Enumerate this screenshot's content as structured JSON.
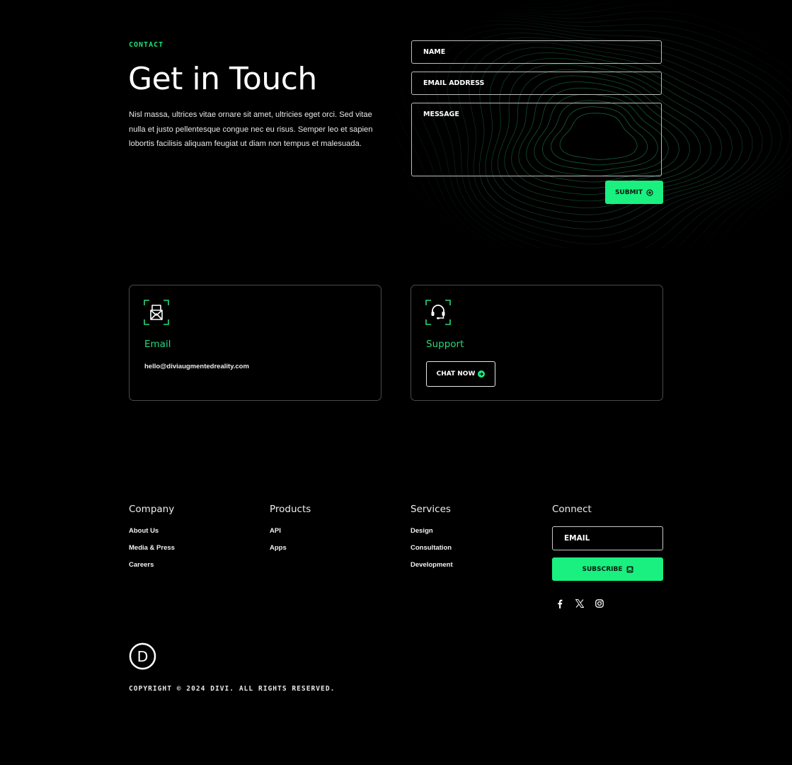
{
  "colors": {
    "accent": "#19f080",
    "accent_text": "#2ad67c",
    "background": "#000000",
    "border": "#bdbdbd"
  },
  "contact": {
    "eyebrow": "CONTACT",
    "title": "Get in Touch",
    "intro": "Nisl massa, ultrices vitae ornare sit amet, ultricies eget orci. Sed vitae nulla et justo pellentesque congue nec eu risus. Semper leo et sapien lobortis facilisis aliquam feugiat ut diam non tempus et malesuada."
  },
  "form": {
    "name_placeholder": "NAME",
    "email_placeholder": "EMAIL ADDRESS",
    "message_placeholder": "MESSAGE",
    "name_value": "",
    "email_value": "",
    "message_value": "",
    "submit_label": "SUBMIT",
    "submit_icon": "target-circle-icon"
  },
  "cards": {
    "email": {
      "icon": "envelope-icon",
      "title": "Email",
      "text": "hello@diviaugmentedreality.com"
    },
    "support": {
      "icon": "headset-icon",
      "title": "Support",
      "button_label": "CHAT NOW",
      "button_icon": "arrow-circle-right-icon"
    }
  },
  "footer": {
    "columns": [
      {
        "title": "Company",
        "links": [
          "About Us",
          "Media & Press",
          "Careers"
        ]
      },
      {
        "title": "Products",
        "links": [
          "API",
          "Apps"
        ]
      },
      {
        "title": "Services",
        "links": [
          "Design",
          "Consultation",
          "Development"
        ]
      }
    ],
    "connect": {
      "title": "Connect",
      "email_placeholder": "EMAIL",
      "subscribe_label": "SUBSCRIBE",
      "subscribe_icon": "mail-open-icon",
      "socials": [
        "facebook-icon",
        "x-icon",
        "instagram-icon"
      ]
    },
    "logo_letter": "D",
    "copyright": "COPYRIGHT © 2024 DIVI. ALL RIGHTS RESERVED."
  }
}
